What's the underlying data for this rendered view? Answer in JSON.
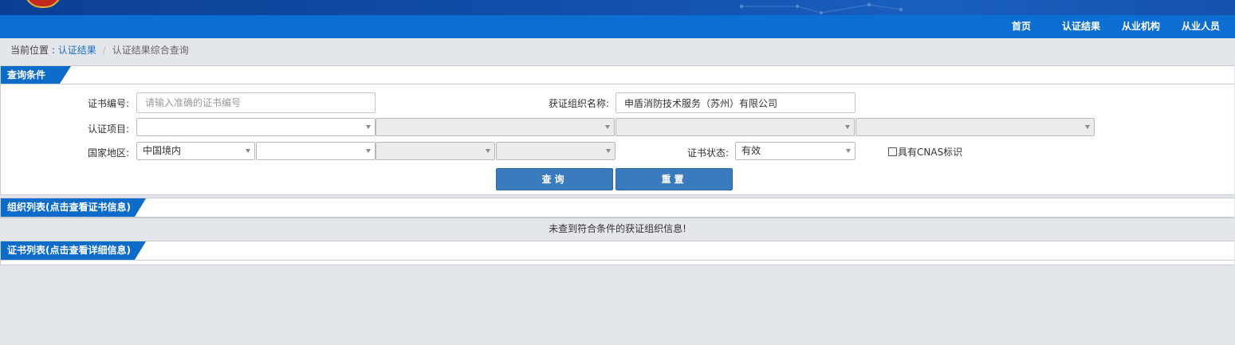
{
  "nav": {
    "home": "首页",
    "results": "认证结果",
    "institutions": "从业机构",
    "personnel": "从业人员"
  },
  "breadcrumb": {
    "prefix": "当前位置 : ",
    "link": "认证结果",
    "separator": "/",
    "current": "认证结果综合查询"
  },
  "query_panel": {
    "title": "查询条件",
    "cert_no_label": "证书编号:",
    "cert_no_placeholder": "请输入准确的证书编号",
    "cert_no_value": "",
    "org_name_label": "获证组织名称:",
    "org_name_value": "申盾消防技术服务（苏州）有限公司",
    "project_label": "认证项目:",
    "region_label": "国家地区:",
    "region_value": "中国境内",
    "status_label": "证书状态:",
    "status_value": "有效",
    "cnas_label": "具有CNAS标识",
    "cnas_checked": false,
    "search_button": "查询",
    "reset_button": "重置"
  },
  "org_panel": {
    "title": "组织列表(点击查看证书信息)",
    "empty_message": "未查到符合条件的获证组织信息!"
  },
  "cert_panel": {
    "title": "证书列表(点击查看详细信息)"
  },
  "colors": {
    "nav_blue": "#0b6ed0",
    "banner_blue": "#1250ad",
    "button_blue": "#3a7bbd",
    "page_bg": "#e3e7eb"
  }
}
